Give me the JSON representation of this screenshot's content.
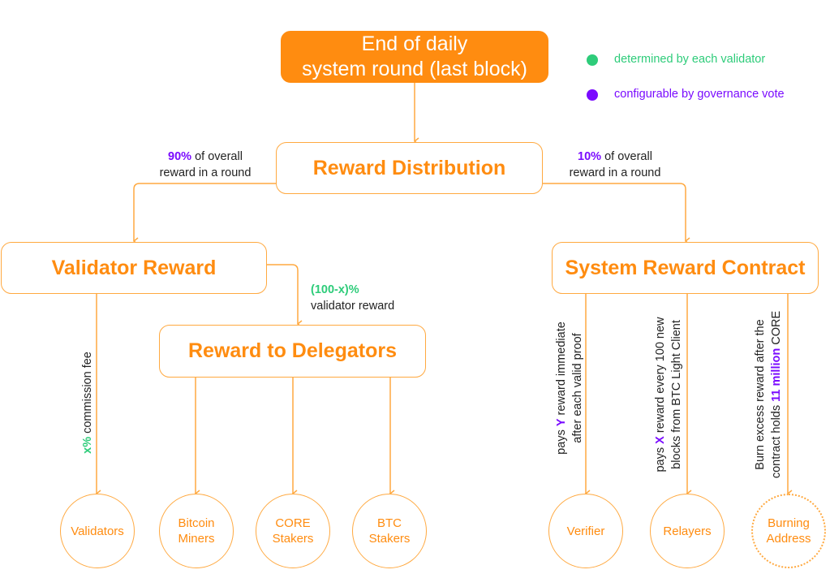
{
  "legend": [
    {
      "label": "determined by each validator",
      "color": "#2ecc7a"
    },
    {
      "label": "configurable by governance vote",
      "color": "#7a0bff"
    }
  ],
  "nodes": {
    "start": {
      "line1": "End of daily",
      "line2": "system round (last block)"
    },
    "distribution": "Reward Distribution",
    "validator_reward": "Validator Reward",
    "delegators": "Reward to Delegators",
    "system_contract": "System Reward Contract"
  },
  "edges": {
    "left_split": {
      "highlight": "90%",
      "text1": " of overall",
      "text2": "reward in a round"
    },
    "right_split": {
      "highlight": "10%",
      "text1": " of overall",
      "text2": "reward in a round"
    },
    "delegator_share": {
      "highlight": "(100-x)%",
      "text": "validator reward"
    },
    "commission": {
      "highlight": "x%",
      "text": " commission fee"
    },
    "verifier": {
      "prefix": "pays ",
      "highlight": "Y",
      "text1": " reward immediate",
      "text2": "after each valid proof"
    },
    "relayers": {
      "prefix": "pays ",
      "highlight": "X",
      "text1": " reward every 100 new",
      "text2": "blocks from BTC Light Client"
    },
    "burn": {
      "text1": "Burn excess reward after the",
      "prefix2": "contract holds ",
      "highlight": "11 million",
      "suffix2": " CORE"
    }
  },
  "recipients": [
    {
      "line1": "Validators",
      "line2": ""
    },
    {
      "line1": "Bitcoin",
      "line2": "Miners"
    },
    {
      "line1": "CORE",
      "line2": "Stakers"
    },
    {
      "line1": "BTC",
      "line2": "Stakers"
    },
    {
      "line1": "Verifier",
      "line2": ""
    },
    {
      "line1": "Relayers",
      "line2": ""
    },
    {
      "line1": "Burning",
      "line2": "Address"
    }
  ],
  "colors": {
    "accent": "#ff8c10",
    "line": "#ffa940",
    "green": "#2ecc7a",
    "purple": "#7a0bff"
  }
}
